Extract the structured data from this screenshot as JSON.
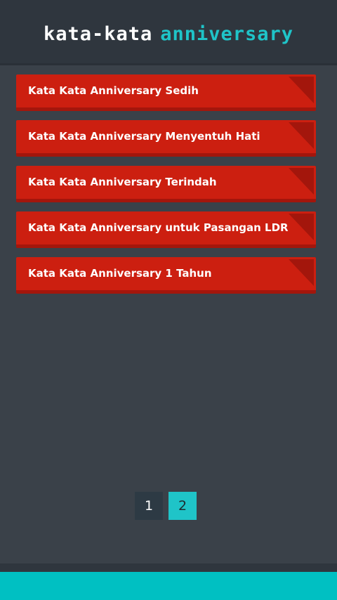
{
  "header": {
    "title_part1": "kata-kata",
    "title_part2": "anniversary"
  },
  "menu": {
    "items": [
      {
        "label": "Kata Kata Anniversary Sedih"
      },
      {
        "label": "Kata Kata Anniversary Menyentuh Hati"
      },
      {
        "label": "Kata Kata Anniversary Terindah"
      },
      {
        "label": "Kata Kata Anniversary untuk Pasangan LDR"
      },
      {
        "label": "Kata Kata Anniversary 1 Tahun"
      }
    ]
  },
  "pagination": {
    "pages": [
      {
        "label": "1",
        "active": false
      },
      {
        "label": "2",
        "active": true
      }
    ]
  },
  "colors": {
    "background": "#3a4149",
    "header": "#2f363e",
    "accent": "#1fc4c8",
    "item_red": "#cc1f10",
    "item_shadow": "#a3160c",
    "footer": "#00c0c2"
  }
}
